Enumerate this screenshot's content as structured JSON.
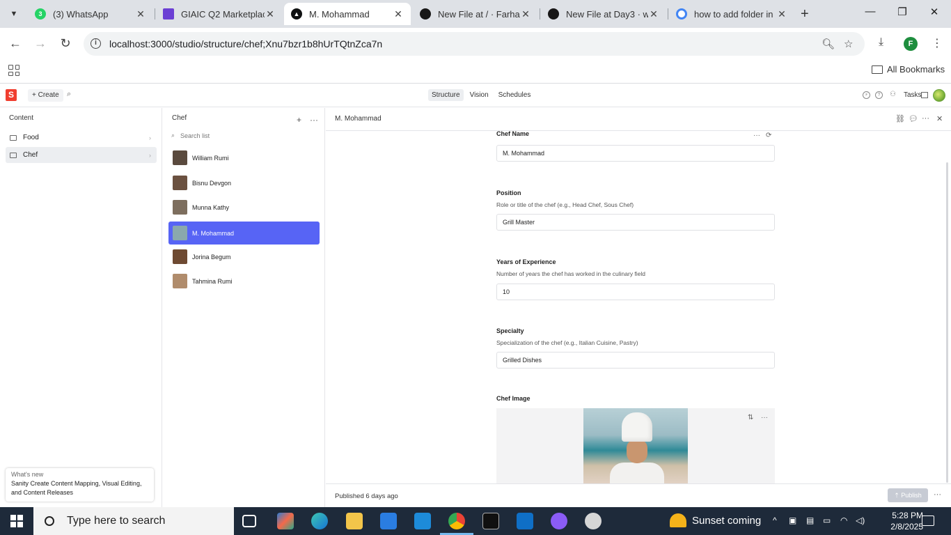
{
  "browser": {
    "tabs": [
      {
        "title": "(3) WhatsApp",
        "badge": "3",
        "color": "#25d366"
      },
      {
        "title": "GIAIC Q2 Marketplace",
        "color": "#6b3fd4"
      },
      {
        "title": "M. Mohammad",
        "color": "#101112"
      },
      {
        "title": "New File at / · Farhan",
        "color": "#181717"
      },
      {
        "title": "New File at Day3 · wa",
        "color": "#181717"
      },
      {
        "title": "how to add folder in",
        "color": "#4285f4"
      }
    ],
    "url": "localhost:3000/studio/structure/chef;Xnu7bzr1b8hUrTQtnZca7n",
    "profile_initial": "F",
    "bookmarks_label": "All Bookmarks"
  },
  "studio": {
    "logo": "S",
    "create_label": "Create",
    "nav_tabs": [
      "Structure",
      "Vision",
      "Schedules"
    ],
    "active_tab": "Structure",
    "tasks_label": "Tasks"
  },
  "content_pane": {
    "title": "Content",
    "items": [
      {
        "label": "Food",
        "selected": false
      },
      {
        "label": "Chef",
        "selected": true
      }
    ],
    "whats_new": {
      "heading": "What's new",
      "text": "Sanity Create Content Mapping, Visual Editing, and Content Releases"
    }
  },
  "list_pane": {
    "title": "Chef",
    "search_placeholder": "Search list",
    "items": [
      {
        "name": "William Rumi",
        "thumb": "#5a4a3e"
      },
      {
        "name": "Bisnu Devgon",
        "thumb": "#6b5140"
      },
      {
        "name": "Munna Kathy",
        "thumb": "#7d6e5e"
      },
      {
        "name": "M. Mohammad",
        "thumb": "#8aa8ad",
        "selected": true
      },
      {
        "name": "Jorina Begum",
        "thumb": "#6e4a32"
      },
      {
        "name": "Tahmina Rumi",
        "thumb": "#b08c6c"
      }
    ]
  },
  "document": {
    "title": "M. Mohammad",
    "fields": [
      {
        "label": "Chef Name",
        "description": "",
        "value": "M. Mohammad"
      },
      {
        "label": "Position",
        "description": "Role or title of the chef (e.g., Head Chef, Sous Chef)",
        "value": "Grill Master"
      },
      {
        "label": "Years of Experience",
        "description": "Number of years the chef has worked in the culinary field",
        "value": "10"
      },
      {
        "label": "Specialty",
        "description": "Specialization of the chef (e.g., Italian Cuisine, Pastry)",
        "value": "Grilled Dishes"
      }
    ],
    "image_label": "Chef Image",
    "status": "Published 6 days ago",
    "publish_label": "Publish"
  },
  "taskbar": {
    "search_placeholder": "Type here to search",
    "weather": "Sunset coming",
    "time": "5:28 PM",
    "date": "2/8/2025"
  },
  "colors": {
    "accent": "#5764f5",
    "sanity_red": "#f03e2f"
  }
}
